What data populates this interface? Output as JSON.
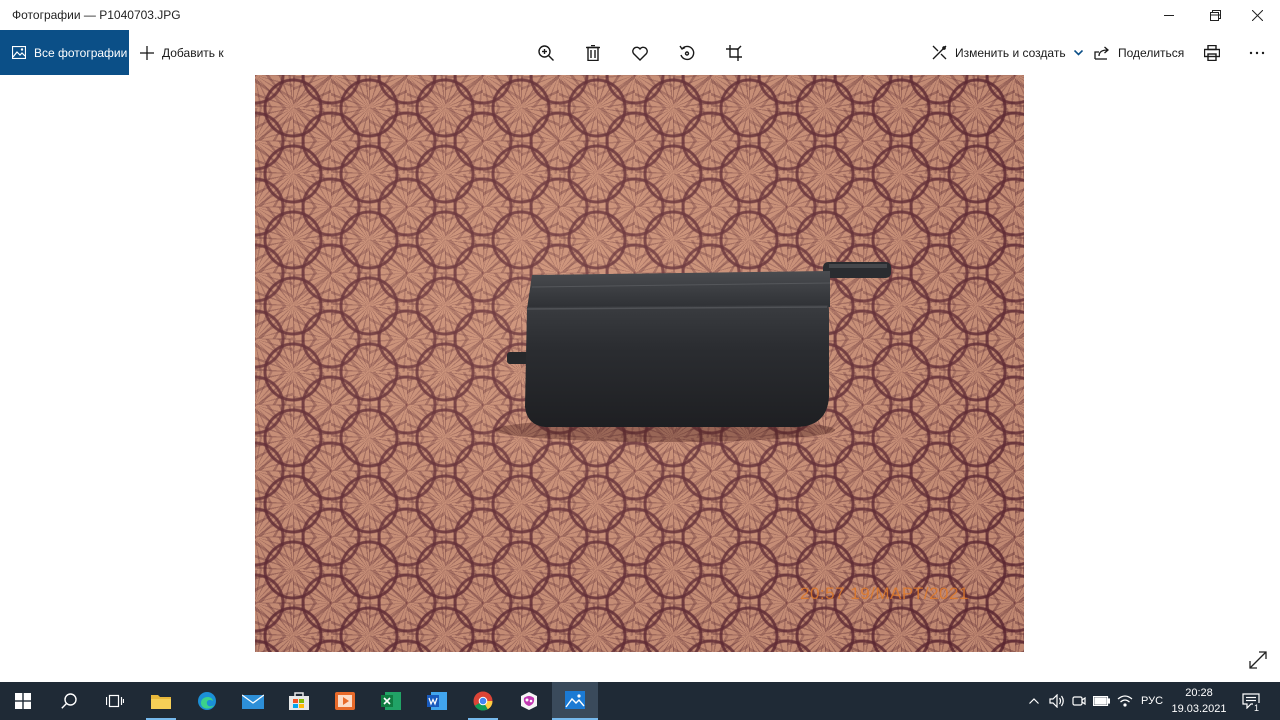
{
  "window": {
    "title": "Фотографии — P1040703.JPG"
  },
  "toolbar": {
    "all_photos_label": "Все фотографии",
    "add_label": "Добавить к",
    "edit_create_label": "Изменить и создать",
    "share_label": "Поделиться"
  },
  "photo": {
    "date_stamp": "20:57 19/МАРТ/2021"
  },
  "taskbar": {
    "language": "РУС",
    "time": "20:28",
    "date": "19.03.2021",
    "notification_count": "1"
  },
  "colors": {
    "accent": "#0b4f87",
    "taskbar": "#1f2a36",
    "stamp": "#e07a2a"
  },
  "icons": {
    "toolbar": [
      "zoom-icon",
      "delete-icon",
      "favorite-icon",
      "rotate-icon",
      "crop-icon",
      "print-icon",
      "more-icon"
    ],
    "taskbar_apps": [
      "start-icon",
      "search-icon",
      "task-view-icon",
      "file-explorer-icon",
      "edge-icon",
      "mail-icon",
      "store-icon",
      "media-player-icon",
      "excel-icon",
      "word-icon",
      "chrome-icon",
      "paint3d-icon",
      "photos-icon"
    ]
  }
}
